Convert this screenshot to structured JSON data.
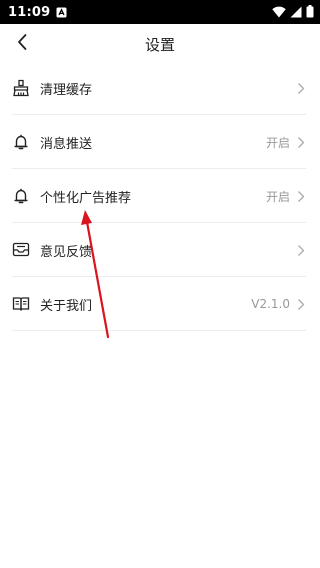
{
  "status_bar": {
    "time": "11:09"
  },
  "header": {
    "title": "设置"
  },
  "settings": {
    "items": [
      {
        "label": "清理缓存",
        "value": ""
      },
      {
        "label": "消息推送",
        "value": "开启"
      },
      {
        "label": "个性化广告推荐",
        "value": "开启"
      },
      {
        "label": "意见反馈",
        "value": ""
      },
      {
        "label": "关于我们",
        "value": "V2.1.0"
      }
    ]
  },
  "colors": {
    "status_bar_bg": "#000000",
    "annotation_arrow": "#d9141e",
    "secondary_text": "#999999",
    "divider": "#ececec"
  }
}
